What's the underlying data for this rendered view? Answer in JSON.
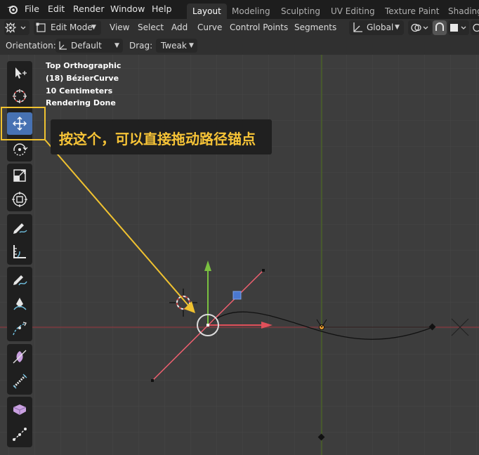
{
  "app": {
    "menus": [
      "File",
      "Edit",
      "Render",
      "Window",
      "Help"
    ],
    "workspaces": [
      "Layout",
      "Modeling",
      "Sculpting",
      "UV Editing",
      "Texture Paint",
      "Shading"
    ],
    "active_workspace": "Layout"
  },
  "header": {
    "mode": "Edit Mode",
    "menus": [
      "View",
      "Select",
      "Add",
      "Curve",
      "Control Points",
      "Segments"
    ],
    "transform_orientation": "Global"
  },
  "tool_settings": {
    "orientation_label": "Orientation:",
    "orientation_value": "Default",
    "drag_label": "Drag:",
    "drag_value": "Tweak"
  },
  "viewport_info": {
    "view": "Top Orthographic",
    "object": "(18) BézierCurve",
    "scale": "10 Centimeters",
    "status": "Rendering Done"
  },
  "toolbar": {
    "tools": [
      "select-box",
      "cursor",
      "move",
      "rotate",
      "scale",
      "transform",
      "annotate",
      "measure",
      "draw",
      "pen",
      "curve-tilt",
      "radius",
      "randomize",
      "extrude",
      "extrude-cursor"
    ],
    "active_tool": "move"
  },
  "annotation": {
    "text": "按这个，可以直接拖动路径锚点"
  },
  "colors": {
    "accent": "#4772b3",
    "highlight": "#f0c230",
    "x_axis": "#c8404a",
    "y_axis": "#6a8f28",
    "grid": "#474747",
    "background": "#3d3d3d"
  }
}
